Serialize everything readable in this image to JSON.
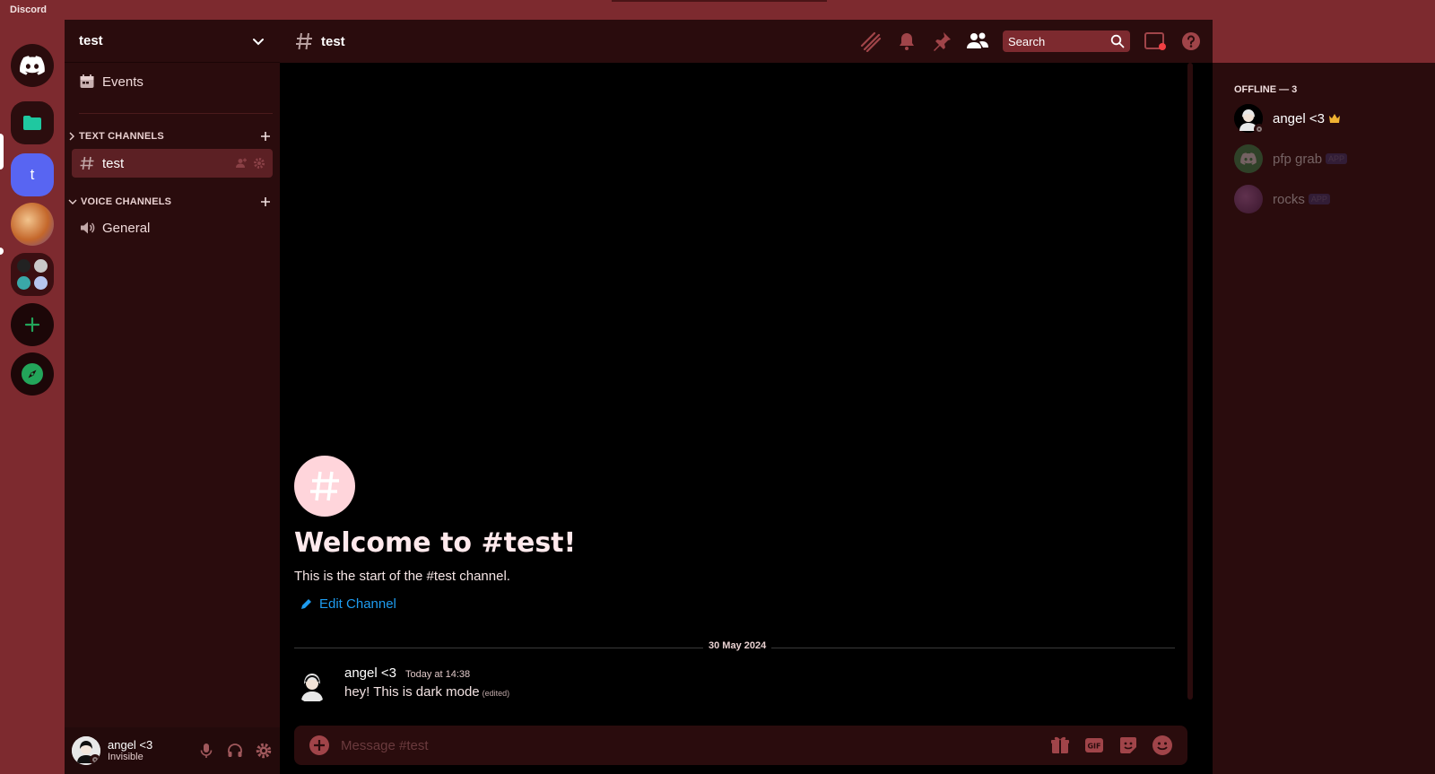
{
  "app": {
    "title": "Discord"
  },
  "server": {
    "name": "test"
  },
  "sidebar": {
    "events_label": "Events",
    "text_category": "TEXT CHANNELS",
    "voice_category": "VOICE CHANNELS",
    "text_channels": [
      {
        "name": "test"
      }
    ],
    "voice_channels": [
      {
        "name": "General"
      }
    ],
    "server_icon_letter": "t"
  },
  "channel": {
    "name": "test",
    "welcome_title": "Welcome to #test!",
    "welcome_sub": "This is the start of the #test channel.",
    "edit_label": "Edit Channel"
  },
  "messages": {
    "date_divider": "30 May 2024",
    "items": [
      {
        "author": "angel <3",
        "time": "Today at 14:38",
        "text": "hey! This is dark mode",
        "edited": "(edited)"
      }
    ]
  },
  "composer": {
    "placeholder": "Message #test"
  },
  "header": {
    "search_placeholder": "Search"
  },
  "members": {
    "offline_header": "OFFLINE — 3",
    "list": [
      {
        "name": "angel <3",
        "badge": "",
        "crown": true
      },
      {
        "name": "pfp grab",
        "badge": "APP"
      },
      {
        "name": "rocks",
        "badge": "APP"
      }
    ]
  },
  "user": {
    "name": "angel <3",
    "status": "Invisible"
  },
  "colors": {
    "accent": "#7d2a2f",
    "panel": "#2a0c0d",
    "blurple": "#5865f2",
    "link": "#1e9cf0"
  },
  "icons": [
    "discord-logo-icon",
    "folder-icon",
    "add-server-icon",
    "explore-icon",
    "calendar-icon",
    "chevron-down-icon",
    "plus-icon",
    "hash-icon",
    "speaker-icon",
    "threads-icon",
    "bell-icon",
    "pin-icon",
    "members-icon",
    "search-icon",
    "inbox-icon",
    "help-icon",
    "pencil-icon",
    "plus-circle-icon",
    "gift-icon",
    "gif-icon",
    "sticker-icon",
    "emoji-icon",
    "mic-icon",
    "headphones-icon",
    "gear-icon",
    "crown-icon"
  ]
}
